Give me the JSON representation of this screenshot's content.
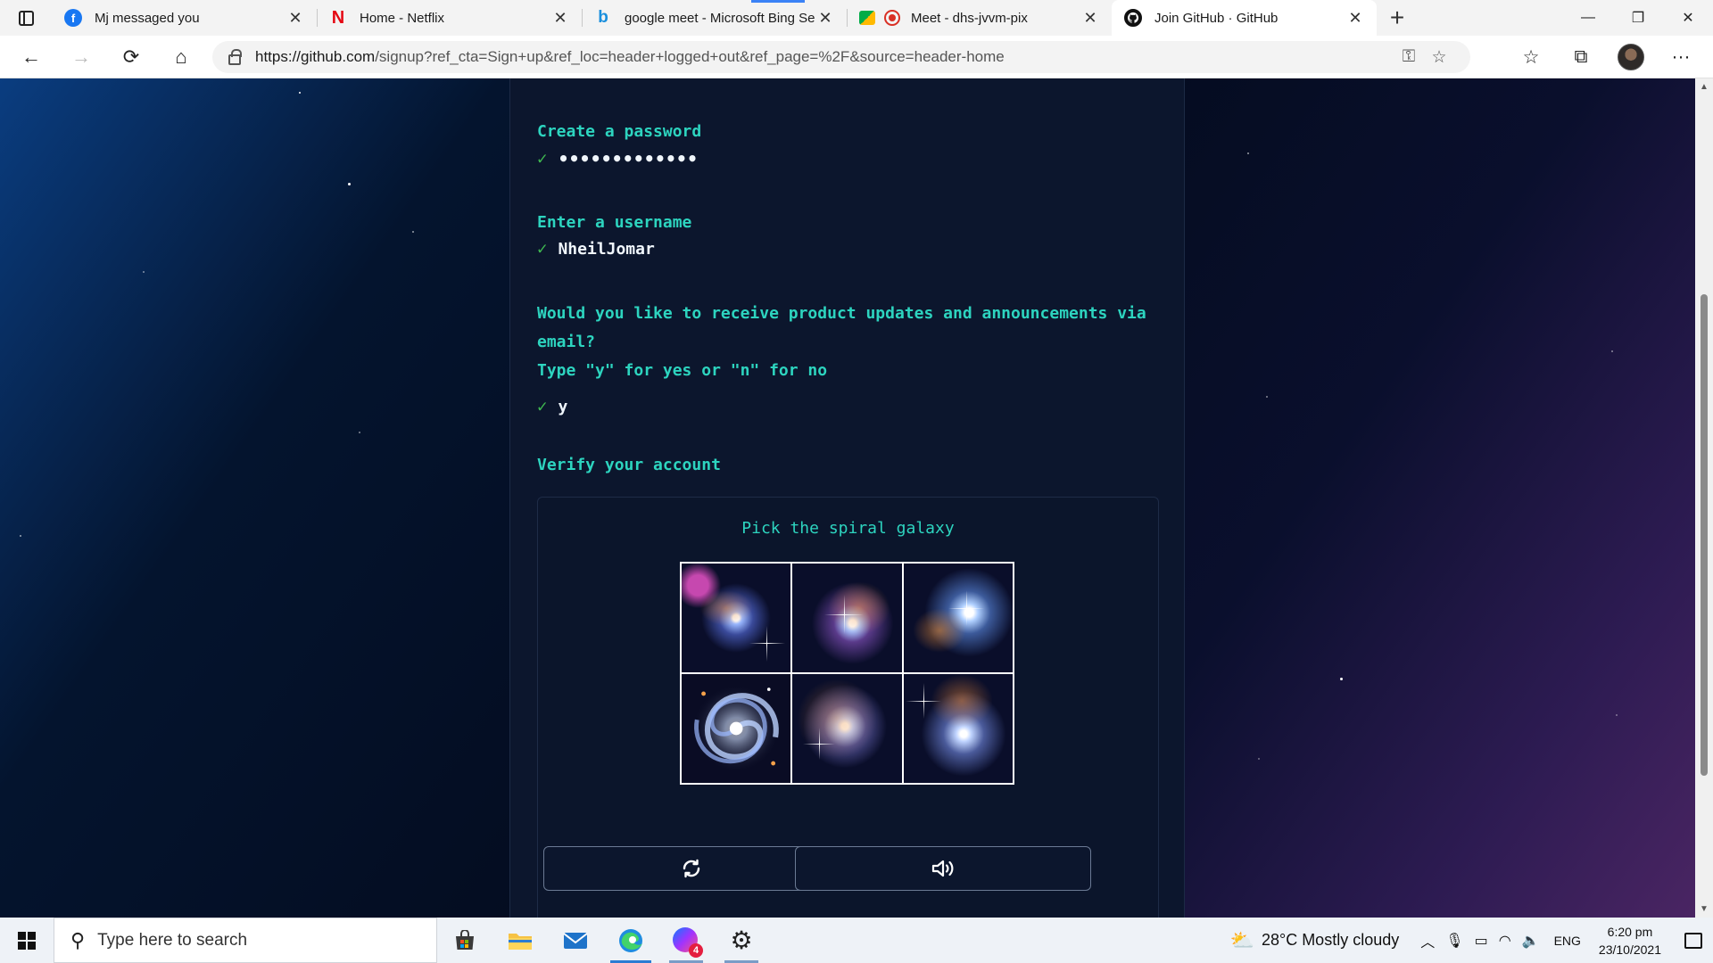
{
  "browser": {
    "tabs": [
      {
        "title": "Mj messaged you",
        "favicon": "facebook-icon",
        "active": false
      },
      {
        "title": "Home - Netflix",
        "favicon": "netflix-icon",
        "active": false
      },
      {
        "title": "google meet - Microsoft Bing Se",
        "favicon": "bing-icon",
        "active": false
      },
      {
        "title": "Meet - dhs-jvvm-pix",
        "favicon": "google-meet-icon",
        "active": false
      },
      {
        "title": "Join GitHub · GitHub",
        "favicon": "github-icon",
        "active": true
      }
    ],
    "new_tab_label": "+",
    "address": {
      "url_domain": "https://github.com",
      "url_rest": "/signup?ref_cta=Sign+up&ref_loc=header+logged+out&ref_page=%2F&source=header-home"
    }
  },
  "signup": {
    "password_prompt": "Create a password",
    "password_value": "•••••••••••••",
    "username_prompt": "Enter a username",
    "username_value": "NheilJomar",
    "email_prompt_line1": "Would you like to receive product updates and announcements via",
    "email_prompt_line2": "email?",
    "email_prompt_line3": "Type \"y\" for yes or \"n\" for no",
    "email_value": "y",
    "check_mark": "✓",
    "verify_prompt": "Verify your account",
    "captcha": {
      "instruction": "Pick the spiral galaxy",
      "images": [
        "galaxy-option-1",
        "galaxy-option-2",
        "galaxy-option-3",
        "galaxy-option-4",
        "galaxy-option-5",
        "galaxy-option-6"
      ],
      "refresh_icon": "refresh-icon",
      "audio_icon": "speaker-icon"
    }
  },
  "taskbar": {
    "search_placeholder": "Type here to search",
    "weather": "28°C  Mostly cloudy",
    "language": "ENG",
    "time": "6:20 pm",
    "date": "23/10/2021",
    "messenger_badge": "4"
  },
  "colors": {
    "accent_teal": "#2dd4bf",
    "check_green": "#3fb950",
    "panel_bg": "#0c162d"
  }
}
